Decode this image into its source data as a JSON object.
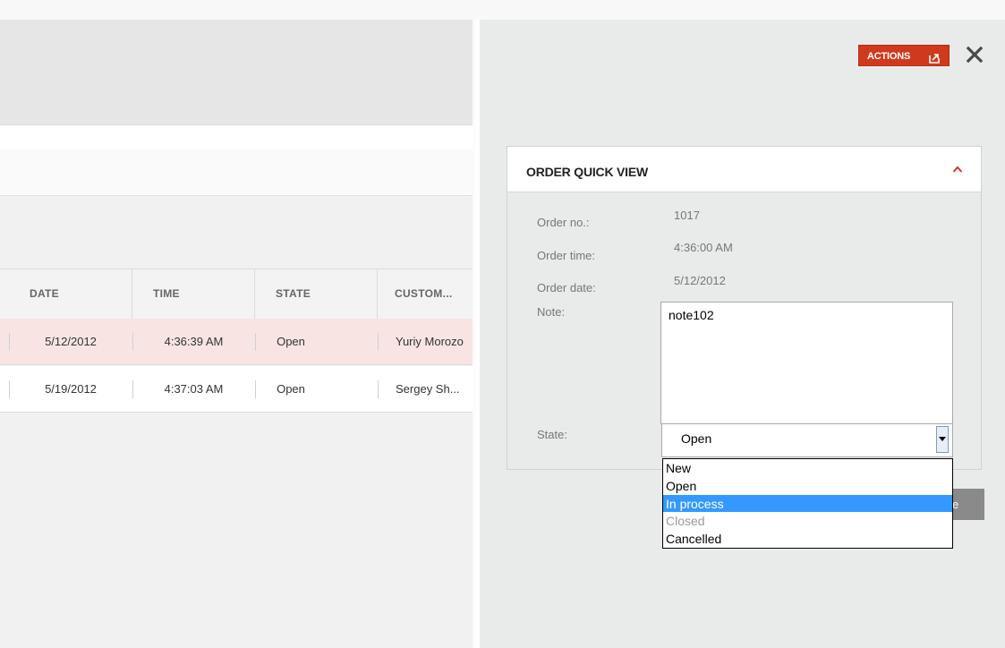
{
  "grid": {
    "columns": [
      "DATE",
      "TIME",
      "STATE",
      "CUSTOM..."
    ],
    "rows": [
      {
        "date": "5/12/2012",
        "time": "4:36:39 AM",
        "state": "Open",
        "customer": "Yuriy Morozo"
      },
      {
        "date": "5/19/2012",
        "time": "4:37:03 AM",
        "state": "Open",
        "customer": "Sergey Sh..."
      }
    ]
  },
  "panel": {
    "actions_label": "ACTIONS",
    "close_icon": "close-icon",
    "quick_view": {
      "title": "ORDER QUICK VIEW",
      "order_no_label": "Order no.:",
      "order_no": "1017",
      "order_time_label": "Order time:",
      "order_time": "4:36:00 AM",
      "order_date_label": "Order date:",
      "order_date": "5/12/2012",
      "note_label": "Note:",
      "note": "note102",
      "state_label": "State:",
      "state_value": "Open",
      "state_options": [
        "New",
        "Open",
        "In process",
        "Closed",
        "Cancelled"
      ],
      "highlighted_option": "In process",
      "disabled_option": "Closed"
    },
    "save_partial": "e"
  },
  "colors": {
    "accent": "#cf3a1e",
    "row_selected": "#f8e5e3",
    "option_highlight": "#3399ff"
  }
}
